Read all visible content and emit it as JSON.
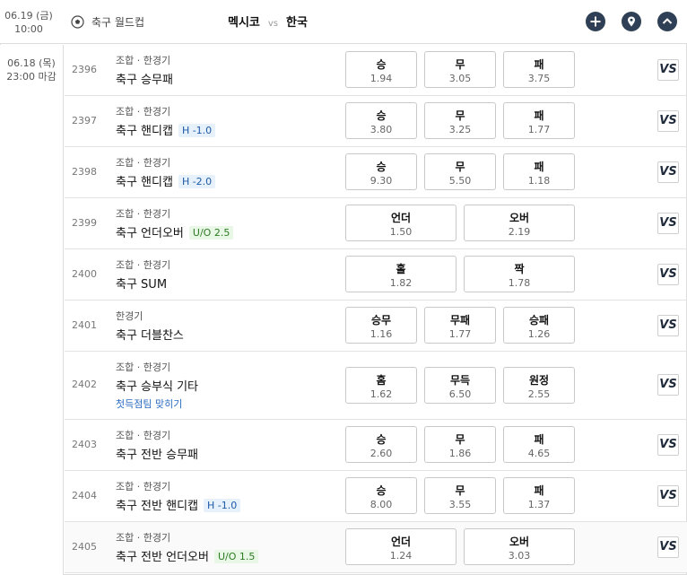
{
  "header": {
    "date": "06.19 (금)",
    "time": "10:00",
    "league": "축구 월드컵",
    "home": "멕시코",
    "vs": "vs",
    "away": "한국"
  },
  "deadline": {
    "date": "06.18 (목)",
    "time": "23:00 마감"
  },
  "rows": [
    {
      "num": "2396",
      "cat": "조합 · 한경기",
      "title": "축구 승무패",
      "tag": "",
      "sub": "",
      "odds": [
        {
          "label": "승",
          "value": "1.94"
        },
        {
          "label": "무",
          "value": "3.05"
        },
        {
          "label": "패",
          "value": "3.75"
        }
      ],
      "vs": "VS"
    },
    {
      "num": "2397",
      "cat": "조합 · 한경기",
      "title": "축구 핸디캡",
      "tag": "H -1.0",
      "sub": "",
      "odds": [
        {
          "label": "승",
          "value": "3.80"
        },
        {
          "label": "무",
          "value": "3.25"
        },
        {
          "label": "패",
          "value": "1.77"
        }
      ],
      "vs": "VS"
    },
    {
      "num": "2398",
      "cat": "조합 · 한경기",
      "title": "축구 핸디캡",
      "tag": "H -2.0",
      "sub": "",
      "odds": [
        {
          "label": "승",
          "value": "9.30"
        },
        {
          "label": "무",
          "value": "5.50"
        },
        {
          "label": "패",
          "value": "1.18"
        }
      ],
      "vs": "VS"
    },
    {
      "num": "2399",
      "cat": "조합 · 한경기",
      "title": "축구 언더오버",
      "tag": "U/O 2.5",
      "sub": "",
      "odds": [
        {
          "label": "언더",
          "value": "1.50"
        },
        {
          "label": "오버",
          "value": "2.19"
        }
      ],
      "vs": "VS"
    },
    {
      "num": "2400",
      "cat": "조합 · 한경기",
      "title": "축구 SUM",
      "tag": "",
      "sub": "",
      "odds": [
        {
          "label": "홀",
          "value": "1.82"
        },
        {
          "label": "짝",
          "value": "1.78"
        }
      ],
      "vs": "VS"
    },
    {
      "num": "2401",
      "cat": "한경기",
      "title": "축구 더블찬스",
      "tag": "",
      "sub": "",
      "odds": [
        {
          "label": "승무",
          "value": "1.16"
        },
        {
          "label": "무패",
          "value": "1.77"
        },
        {
          "label": "승패",
          "value": "1.26"
        }
      ],
      "vs": "VS"
    },
    {
      "num": "2402",
      "cat": "조합 · 한경기",
      "title": "축구 승부식 기타",
      "tag": "",
      "sub": "첫득점팀 맞히기",
      "odds": [
        {
          "label": "홈",
          "value": "1.62"
        },
        {
          "label": "무득",
          "value": "6.50"
        },
        {
          "label": "원정",
          "value": "2.55"
        }
      ],
      "vs": "VS"
    },
    {
      "num": "2403",
      "cat": "조합 · 한경기",
      "title": "축구 전반 승무패",
      "tag": "",
      "sub": "",
      "odds": [
        {
          "label": "승",
          "value": "2.60"
        },
        {
          "label": "무",
          "value": "1.86"
        },
        {
          "label": "패",
          "value": "4.65"
        }
      ],
      "vs": "VS"
    },
    {
      "num": "2404",
      "cat": "조합 · 한경기",
      "title": "축구 전반 핸디캡",
      "tag": "H -1.0",
      "sub": "",
      "odds": [
        {
          "label": "승",
          "value": "8.00"
        },
        {
          "label": "무",
          "value": "3.55"
        },
        {
          "label": "패",
          "value": "1.37"
        }
      ],
      "vs": "VS"
    },
    {
      "num": "2405",
      "cat": "조합 · 한경기",
      "title": "축구 전반 언더오버",
      "tag": "U/O 1.5",
      "sub": "",
      "odds": [
        {
          "label": "언더",
          "value": "1.24"
        },
        {
          "label": "오버",
          "value": "3.03"
        }
      ],
      "vs": "VS"
    }
  ],
  "icons": {
    "ball": "soccer-ball-icon",
    "plus": "plus-icon",
    "pin": "location-pin-icon",
    "up": "chevron-up-icon"
  },
  "colors": {
    "header_button": "#2f3f55",
    "handicap_tag": "#1f5aa8",
    "uo_tag": "#2e7a24",
    "link": "#2a6bc1"
  }
}
